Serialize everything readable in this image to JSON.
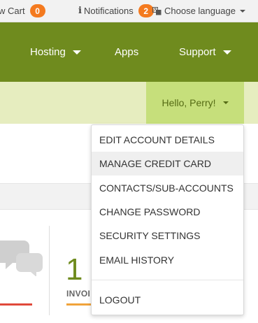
{
  "topbar": {
    "cart_label": "w Cart",
    "cart_count": "0",
    "notifications_label": "Notifications",
    "notifications_count": "2",
    "language_label": "Choose language",
    "badge_color": "#f47a1f"
  },
  "navbar": {
    "background": "#6f8b1e",
    "items": [
      {
        "label": "Hosting",
        "has_caret": true
      },
      {
        "label": "Apps",
        "has_caret": false
      },
      {
        "label": "Support",
        "has_caret": true
      }
    ]
  },
  "account": {
    "greeting": "Hello, Perry!"
  },
  "account_menu": {
    "items": [
      {
        "label": "EDIT ACCOUNT DETAILS"
      },
      {
        "label": "MANAGE CREDIT CARD",
        "highlighted": true
      },
      {
        "label": "CONTACTS/SUB-ACCOUNTS"
      },
      {
        "label": "CHANGE PASSWORD"
      },
      {
        "label": "SECURITY SETTINGS"
      },
      {
        "label": "EMAIL HISTORY"
      }
    ],
    "logout_label": "LOGOUT"
  },
  "stats": {
    "invoices_count": "1",
    "invoices_label": "INVOI",
    "icons": [
      "chat-bubbles-icon"
    ]
  }
}
